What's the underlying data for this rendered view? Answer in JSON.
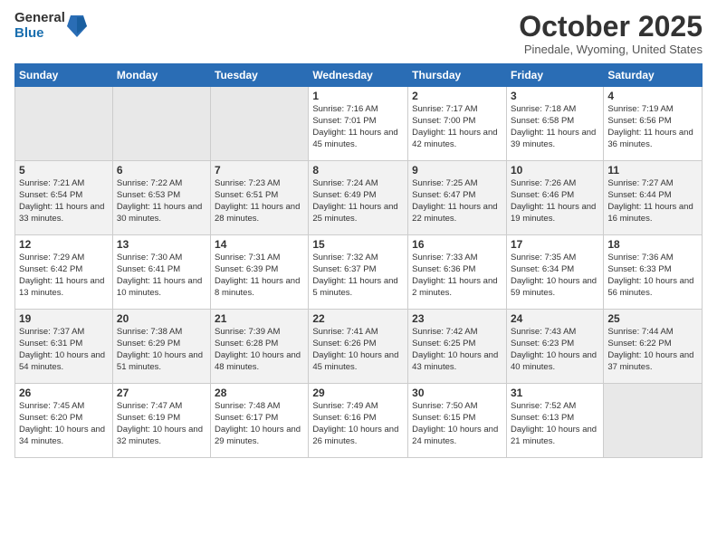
{
  "logo": {
    "general": "General",
    "blue": "Blue"
  },
  "header": {
    "month": "October 2025",
    "location": "Pinedale, Wyoming, United States"
  },
  "days_of_week": [
    "Sunday",
    "Monday",
    "Tuesday",
    "Wednesday",
    "Thursday",
    "Friday",
    "Saturday"
  ],
  "weeks": [
    [
      {
        "day": "",
        "info": ""
      },
      {
        "day": "",
        "info": ""
      },
      {
        "day": "",
        "info": ""
      },
      {
        "day": "1",
        "info": "Sunrise: 7:16 AM\nSunset: 7:01 PM\nDaylight: 11 hours and 45 minutes."
      },
      {
        "day": "2",
        "info": "Sunrise: 7:17 AM\nSunset: 7:00 PM\nDaylight: 11 hours and 42 minutes."
      },
      {
        "day": "3",
        "info": "Sunrise: 7:18 AM\nSunset: 6:58 PM\nDaylight: 11 hours and 39 minutes."
      },
      {
        "day": "4",
        "info": "Sunrise: 7:19 AM\nSunset: 6:56 PM\nDaylight: 11 hours and 36 minutes."
      }
    ],
    [
      {
        "day": "5",
        "info": "Sunrise: 7:21 AM\nSunset: 6:54 PM\nDaylight: 11 hours and 33 minutes."
      },
      {
        "day": "6",
        "info": "Sunrise: 7:22 AM\nSunset: 6:53 PM\nDaylight: 11 hours and 30 minutes."
      },
      {
        "day": "7",
        "info": "Sunrise: 7:23 AM\nSunset: 6:51 PM\nDaylight: 11 hours and 28 minutes."
      },
      {
        "day": "8",
        "info": "Sunrise: 7:24 AM\nSunset: 6:49 PM\nDaylight: 11 hours and 25 minutes."
      },
      {
        "day": "9",
        "info": "Sunrise: 7:25 AM\nSunset: 6:47 PM\nDaylight: 11 hours and 22 minutes."
      },
      {
        "day": "10",
        "info": "Sunrise: 7:26 AM\nSunset: 6:46 PM\nDaylight: 11 hours and 19 minutes."
      },
      {
        "day": "11",
        "info": "Sunrise: 7:27 AM\nSunset: 6:44 PM\nDaylight: 11 hours and 16 minutes."
      }
    ],
    [
      {
        "day": "12",
        "info": "Sunrise: 7:29 AM\nSunset: 6:42 PM\nDaylight: 11 hours and 13 minutes."
      },
      {
        "day": "13",
        "info": "Sunrise: 7:30 AM\nSunset: 6:41 PM\nDaylight: 11 hours and 10 minutes."
      },
      {
        "day": "14",
        "info": "Sunrise: 7:31 AM\nSunset: 6:39 PM\nDaylight: 11 hours and 8 minutes."
      },
      {
        "day": "15",
        "info": "Sunrise: 7:32 AM\nSunset: 6:37 PM\nDaylight: 11 hours and 5 minutes."
      },
      {
        "day": "16",
        "info": "Sunrise: 7:33 AM\nSunset: 6:36 PM\nDaylight: 11 hours and 2 minutes."
      },
      {
        "day": "17",
        "info": "Sunrise: 7:35 AM\nSunset: 6:34 PM\nDaylight: 10 hours and 59 minutes."
      },
      {
        "day": "18",
        "info": "Sunrise: 7:36 AM\nSunset: 6:33 PM\nDaylight: 10 hours and 56 minutes."
      }
    ],
    [
      {
        "day": "19",
        "info": "Sunrise: 7:37 AM\nSunset: 6:31 PM\nDaylight: 10 hours and 54 minutes."
      },
      {
        "day": "20",
        "info": "Sunrise: 7:38 AM\nSunset: 6:29 PM\nDaylight: 10 hours and 51 minutes."
      },
      {
        "day": "21",
        "info": "Sunrise: 7:39 AM\nSunset: 6:28 PM\nDaylight: 10 hours and 48 minutes."
      },
      {
        "day": "22",
        "info": "Sunrise: 7:41 AM\nSunset: 6:26 PM\nDaylight: 10 hours and 45 minutes."
      },
      {
        "day": "23",
        "info": "Sunrise: 7:42 AM\nSunset: 6:25 PM\nDaylight: 10 hours and 43 minutes."
      },
      {
        "day": "24",
        "info": "Sunrise: 7:43 AM\nSunset: 6:23 PM\nDaylight: 10 hours and 40 minutes."
      },
      {
        "day": "25",
        "info": "Sunrise: 7:44 AM\nSunset: 6:22 PM\nDaylight: 10 hours and 37 minutes."
      }
    ],
    [
      {
        "day": "26",
        "info": "Sunrise: 7:45 AM\nSunset: 6:20 PM\nDaylight: 10 hours and 34 minutes."
      },
      {
        "day": "27",
        "info": "Sunrise: 7:47 AM\nSunset: 6:19 PM\nDaylight: 10 hours and 32 minutes."
      },
      {
        "day": "28",
        "info": "Sunrise: 7:48 AM\nSunset: 6:17 PM\nDaylight: 10 hours and 29 minutes."
      },
      {
        "day": "29",
        "info": "Sunrise: 7:49 AM\nSunset: 6:16 PM\nDaylight: 10 hours and 26 minutes."
      },
      {
        "day": "30",
        "info": "Sunrise: 7:50 AM\nSunset: 6:15 PM\nDaylight: 10 hours and 24 minutes."
      },
      {
        "day": "31",
        "info": "Sunrise: 7:52 AM\nSunset: 6:13 PM\nDaylight: 10 hours and 21 minutes."
      },
      {
        "day": "",
        "info": ""
      }
    ]
  ]
}
